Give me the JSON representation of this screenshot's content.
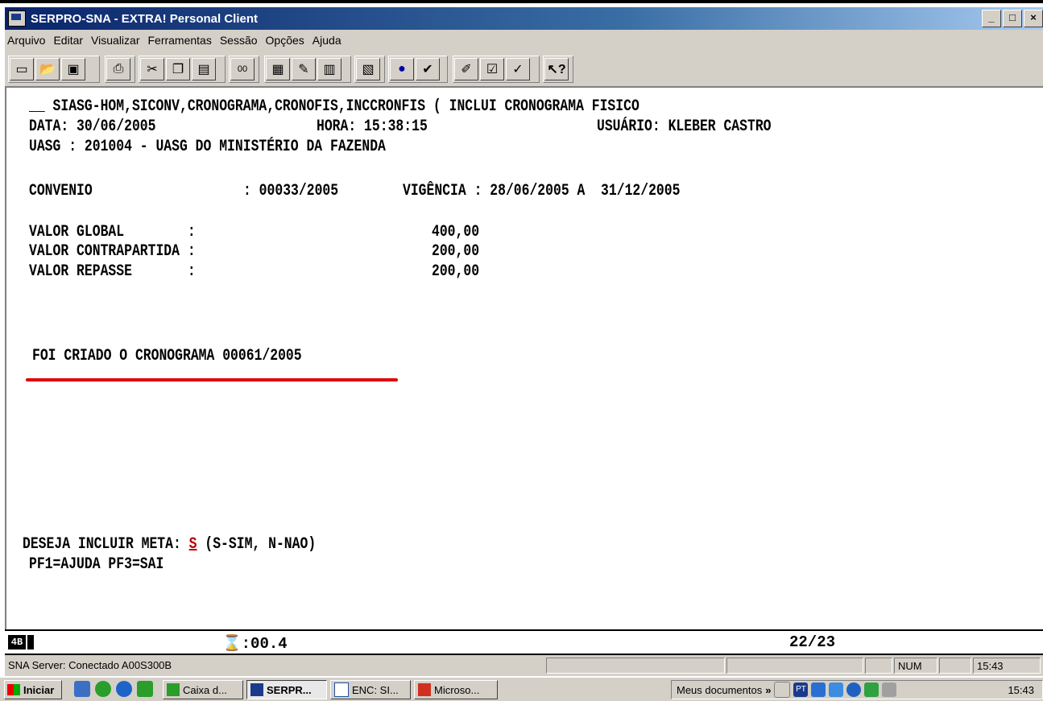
{
  "window": {
    "title": "SERPRO-SNA - EXTRA! Personal Client",
    "buttons": [
      "_",
      "□",
      "×"
    ]
  },
  "menu": [
    "Arquivo",
    "Editar",
    "Visualizar",
    "Ferramentas",
    "Sessão",
    "Opções",
    "Ajuda"
  ],
  "toolbar": {
    "icons": [
      "new-icon",
      "open-icon",
      "save-icon",
      "print-icon",
      "cut-icon",
      "copy-icon",
      "paste-icon",
      "connect-icon",
      "send-file-icon",
      "tools-icon",
      "printer-session-icon",
      "receive-icon",
      "record-icon",
      "macro-icon",
      "edit-macro-icon",
      "settings-icon",
      "quickpad-icon",
      "help-icon"
    ]
  },
  "terminal": {
    "line1": "__ SIASG-HOM,SICONV,CRONOGRAMA,CRONOFIS,INCCRONFIS ( INCLUI CRONOGRAMA FISICO",
    "data": "DATA: 30/06/2005",
    "hora": "HORA: 15:38:15",
    "usuario": "USUÁRIO: KLEBER CASTRO",
    "uasg": "UASG : 201004 - UASG DO MINISTÉRIO DA FAZENDA",
    "convenio_label": "CONVENIO",
    "convenio_value": ": 00033/2005",
    "vigencia": "VIGÊNCIA : 28/06/2005 A  31/12/2005",
    "valor_global_label": "VALOR GLOBAL        :",
    "valor_global": "400,00",
    "valor_contrapartida_label": "VALOR CONTRAPARTIDA :",
    "valor_contrapartida": "200,00",
    "valor_repasse_label": "VALOR REPASSE       :",
    "valor_repasse": "200,00",
    "mensagem": "FOI CRIADO O CRONOGRAMA 00061/2005",
    "prompt_before": "DESEJA INCLUIR META: ",
    "prompt_value": "S",
    "prompt_after": " (S-SIM, N-NAO)",
    "pf_keys": "PF1=AJUDA PF3=SAI"
  },
  "oia": {
    "mode": "4B",
    "timer": "⌛:00.4",
    "cursor_pos": "22/23"
  },
  "statusbar": {
    "server": "SNA Server: Conectado A00S300B",
    "num": "NUM",
    "time": "15:43"
  },
  "taskbar": {
    "start": "Iniciar",
    "tasks": [
      "Caixa d...",
      "SERPR...",
      "ENC: SI...",
      "Microso..."
    ],
    "address": "Meus documentos",
    "chevron": "»",
    "tray_lang": "PT",
    "clock": "15:43"
  }
}
